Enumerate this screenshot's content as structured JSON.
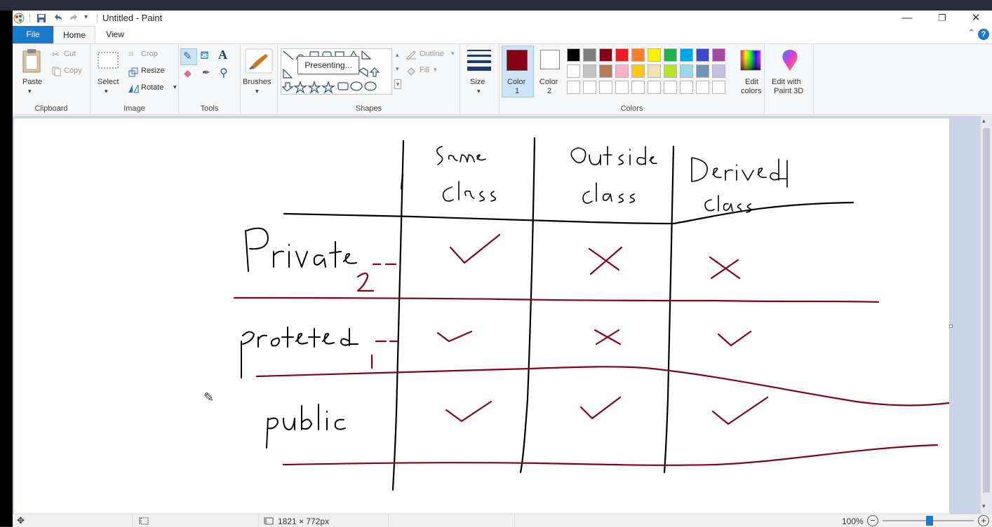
{
  "titlebar": {
    "title": "Untitled - Paint",
    "minimize_glyph": "—",
    "restore_glyph": "❐",
    "close_glyph": "✕"
  },
  "tabs": {
    "file": "File",
    "home": "Home",
    "view": "View"
  },
  "ribbon": {
    "clipboard": {
      "group": "Clipboard",
      "paste": "Paste",
      "cut": "Cut",
      "copy": "Copy"
    },
    "image": {
      "group": "Image",
      "select": "Select",
      "crop": "Crop",
      "resize": "Resize",
      "rotate": "Rotate"
    },
    "tools": {
      "group": "Tools"
    },
    "brushes": {
      "label": "Brushes"
    },
    "shapes": {
      "group": "Shapes",
      "outline": "Outline",
      "fill": "Fill",
      "tooltip": "Presenting..."
    },
    "size": {
      "label": "Size"
    },
    "colors": {
      "group": "Colors",
      "color1_label": "Color",
      "color1_num": "1",
      "color2_label": "Color",
      "color2_num": "2",
      "color1_value": "#880015",
      "color2_value": "#ffffff",
      "edit_colors_1": "Edit",
      "edit_colors_2": "colors",
      "paint3d_1": "Edit with",
      "paint3d_2": "Paint 3D",
      "palette_row1": [
        "#000000",
        "#7f7f7f",
        "#880015",
        "#ed1c24",
        "#ff7f27",
        "#fff200",
        "#22b14c",
        "#00a2e8",
        "#3f48cc",
        "#a349a4"
      ],
      "palette_row2": [
        "#ffffff",
        "#c3c3c3",
        "#b97a57",
        "#ffaec9",
        "#ffc90e",
        "#efe4b0",
        "#b5e61d",
        "#99d9ea",
        "#7092be",
        "#c8bfe7"
      ],
      "palette_row3": [
        "#ffffff",
        "#ffffff",
        "#ffffff",
        "#ffffff",
        "#ffffff",
        "#ffffff",
        "#ffffff",
        "#ffffff",
        "#ffffff",
        "#ffffff"
      ]
    }
  },
  "statusbar": {
    "canvas_size": "1821 × 772px",
    "zoom": "100%"
  },
  "drawing": {
    "headers": [
      "Same Class",
      "Outside class",
      "Derived Class"
    ],
    "rows": [
      "Private",
      "protected",
      "public"
    ],
    "annotations": [
      "2",
      "1"
    ],
    "ink_black": "#000000",
    "ink_red": "#880015"
  }
}
